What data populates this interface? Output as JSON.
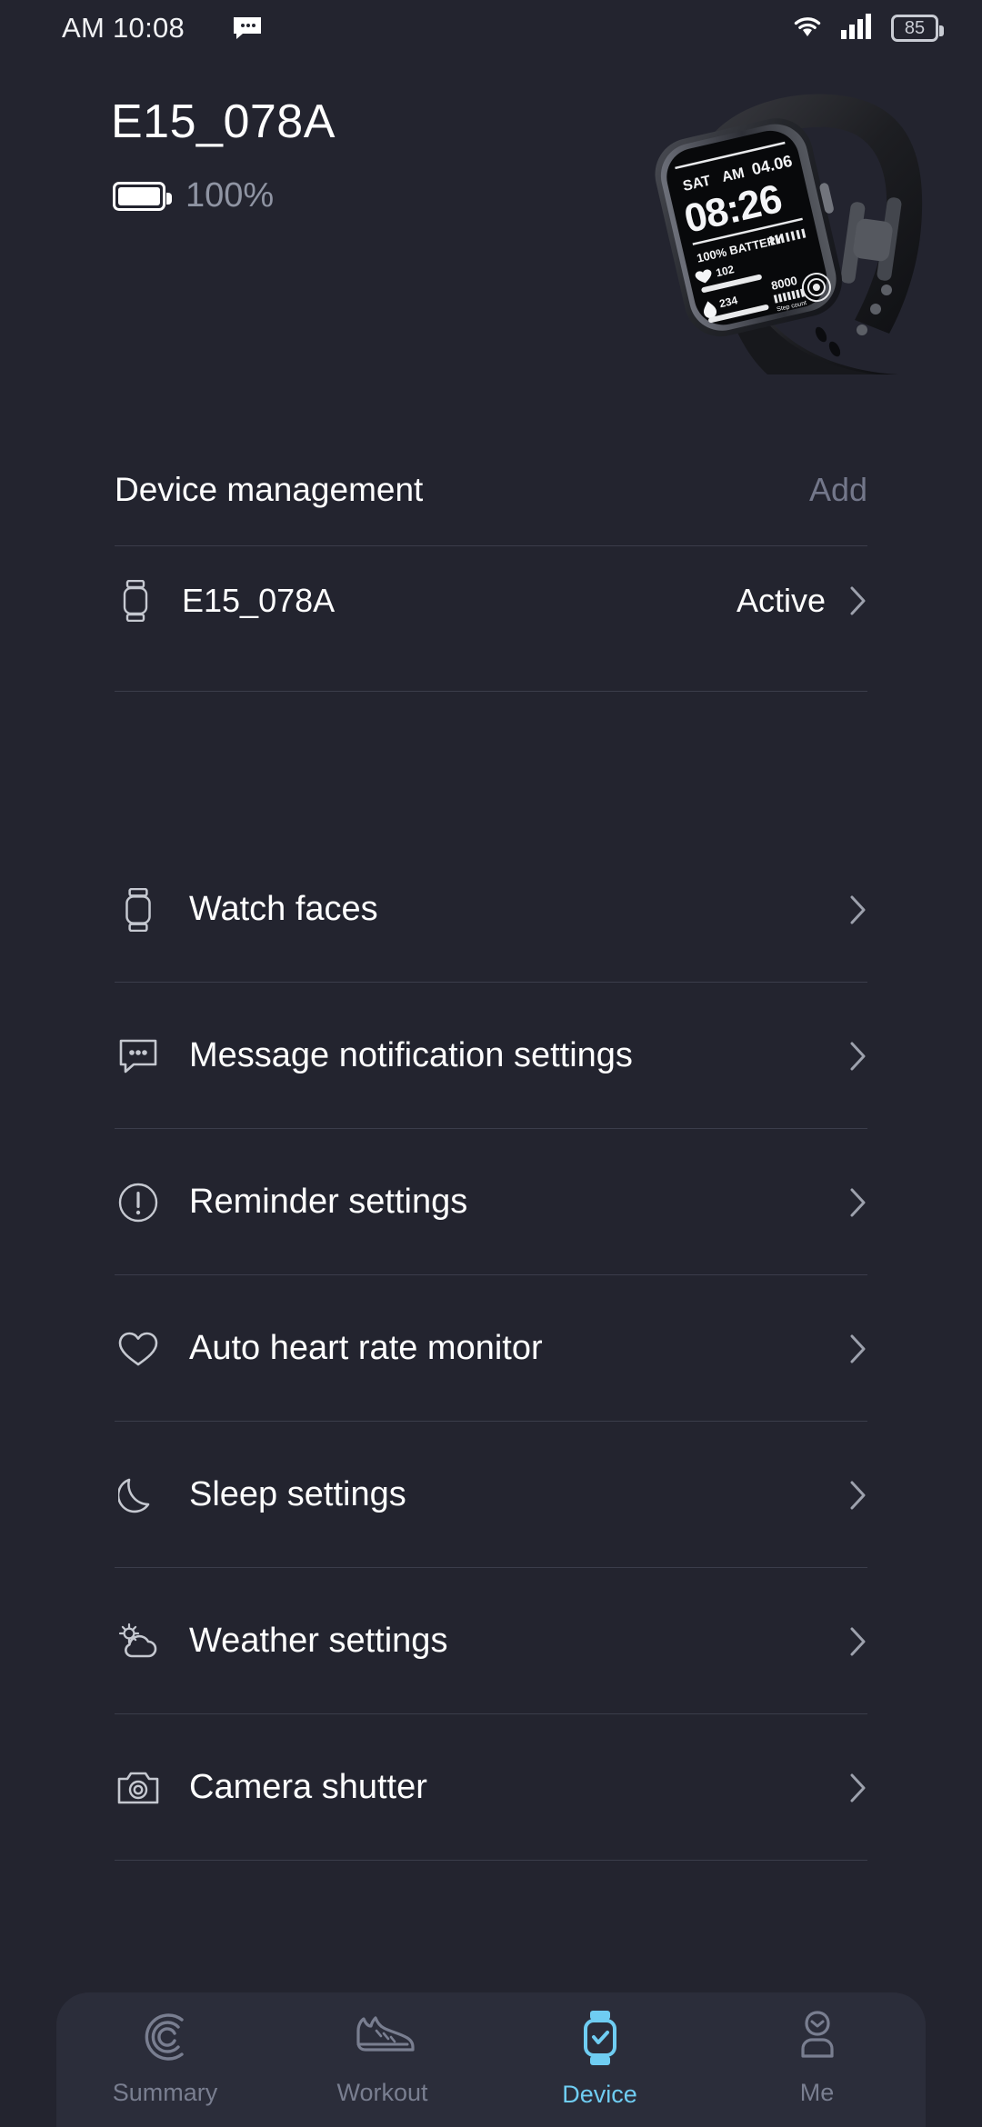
{
  "colors": {
    "background": "#23242f",
    "accent": "#6fcdf2",
    "muted": "#73778a",
    "divider": "#3b3d4b",
    "tabbar": "#2b2d3a"
  },
  "statusbar": {
    "time": "AM 10:08",
    "message_icon": "message-icon",
    "wifi_icon": "wifi-icon",
    "signal_icon": "cellular-signal-icon",
    "battery_level": "85"
  },
  "header": {
    "device_name": "E15_078A",
    "battery_icon": "battery-full-icon",
    "battery_percent": "100%",
    "watch_image": {
      "alt": "smartwatch-product-photo",
      "face": {
        "weekday": "SAT",
        "meridiem": "AM",
        "date": "04.06",
        "time": "08:26",
        "battery_text": "100% BATTERY",
        "heart_rate": "102",
        "calories": "234",
        "steps": "8000",
        "steps_label": "Step count"
      }
    }
  },
  "device_management": {
    "title": "Device management",
    "add_label": "Add",
    "devices": [
      {
        "icon": "watch-icon",
        "name": "E15_078A",
        "status": "Active",
        "chevron": "chevron-right-icon"
      }
    ]
  },
  "menu": {
    "items": [
      {
        "icon": "watch-icon",
        "label": "Watch faces"
      },
      {
        "icon": "message-bubble-icon",
        "label": "Message notification settings"
      },
      {
        "icon": "alert-circle-icon",
        "label": "Reminder settings"
      },
      {
        "icon": "heart-icon",
        "label": "Auto heart rate monitor"
      },
      {
        "icon": "moon-icon",
        "label": "Sleep settings"
      },
      {
        "icon": "weather-cloud-sun-icon",
        "label": "Weather settings"
      },
      {
        "icon": "camera-icon",
        "label": "Camera shutter"
      }
    ]
  },
  "tabbar": {
    "active_index": 2,
    "tabs": [
      {
        "icon": "summary-rings-icon",
        "label": "Summary"
      },
      {
        "icon": "running-shoe-icon",
        "label": "Workout"
      },
      {
        "icon": "watch-check-icon",
        "label": "Device"
      },
      {
        "icon": "person-icon",
        "label": "Me"
      }
    ]
  }
}
